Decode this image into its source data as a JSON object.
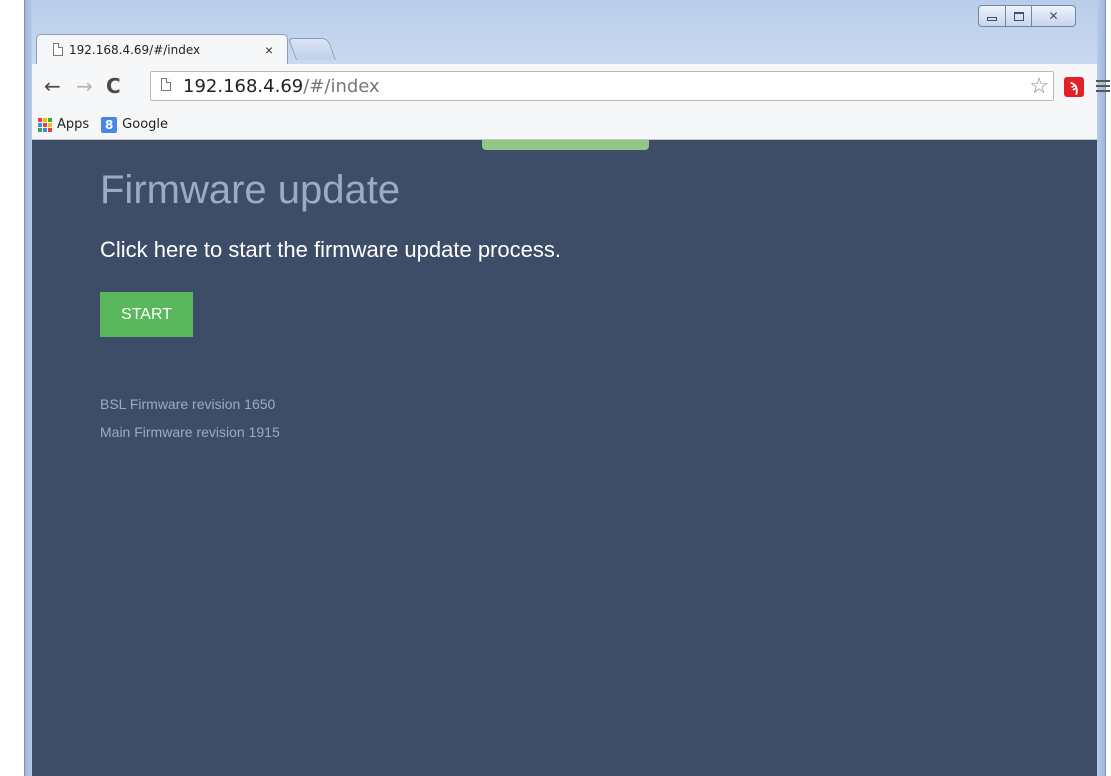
{
  "browser": {
    "tab": {
      "title": "192.168.4.69/#/index",
      "close": "×"
    },
    "toolbar": {
      "back": "←",
      "forward": "→",
      "reload": "C",
      "url_host": "192.168.4.69",
      "url_path": "/#/index",
      "star": "☆",
      "extension_label": "ϡ"
    },
    "bookmarks": {
      "apps_label": "Apps",
      "google_icon": "8",
      "google_label": "Google"
    },
    "window_controls": {
      "close": "✕"
    }
  },
  "page": {
    "title": "Firmware update",
    "subtitle": "Click here to start the firmware update process.",
    "start_button": "START",
    "bsl_revision": "BSL Firmware revision 1650",
    "main_revision": "Main Firmware revision 1915"
  },
  "colors": {
    "page_background": "#3d4d67",
    "title_color": "#9aabc8",
    "start_button": "#59b85b",
    "top_accent": "#93c586"
  }
}
